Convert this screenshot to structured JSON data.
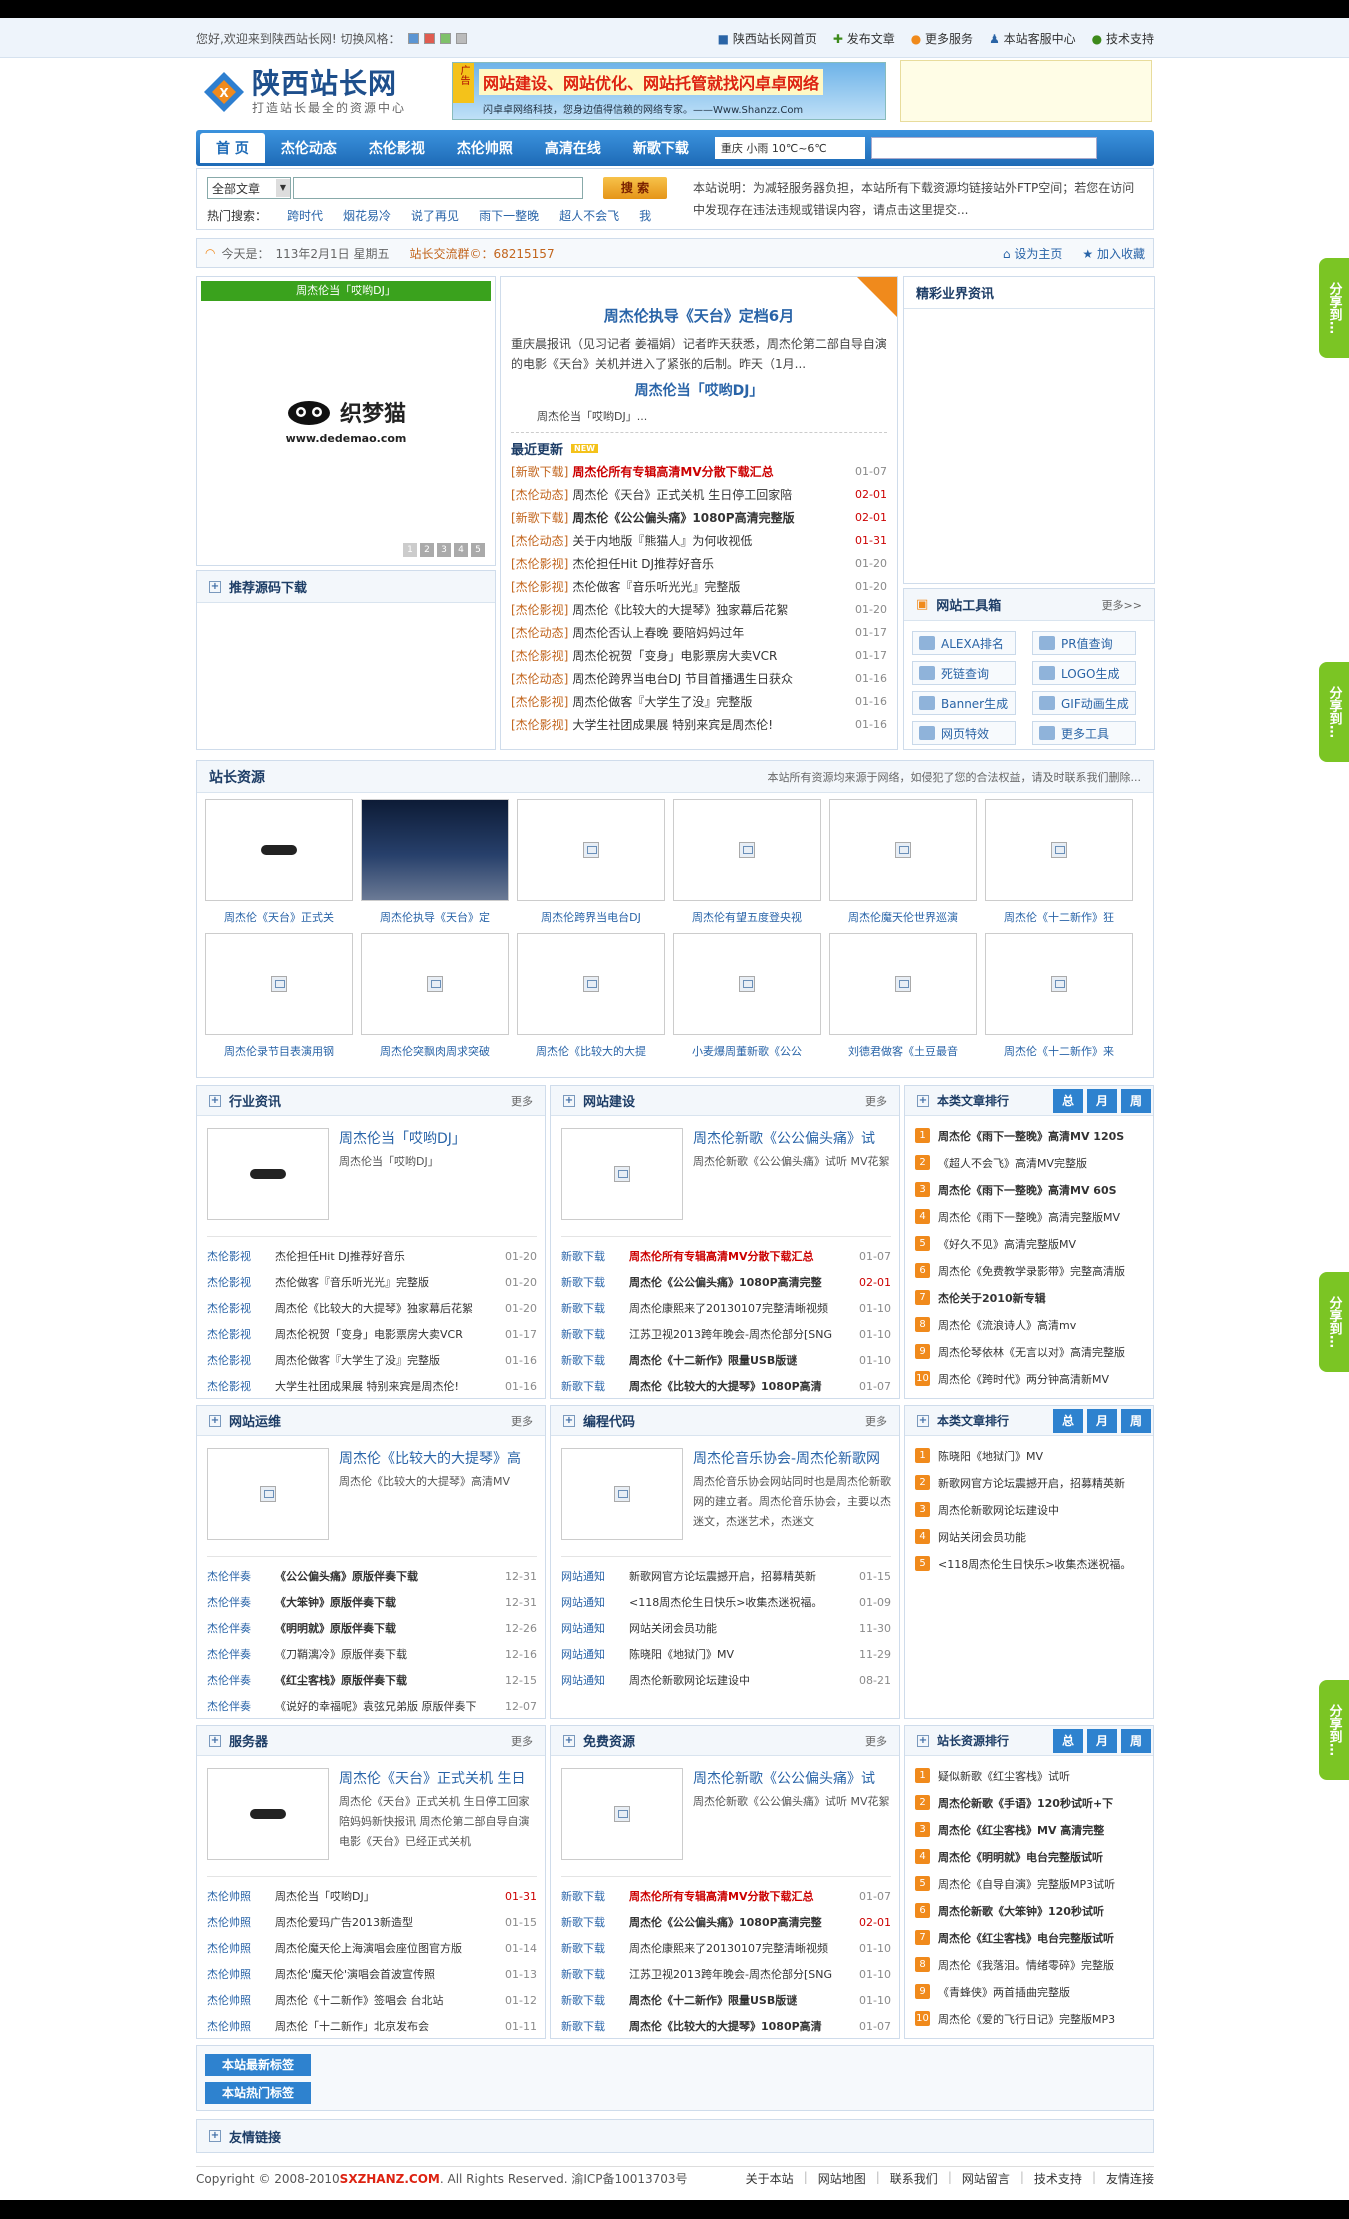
{
  "topbar": {
    "welcome": "您好,欢迎来到陕西站长网! 切换风格：",
    "links": [
      "陕西站长网首页",
      "发布文章",
      "更多服务",
      "本站客服中心",
      "技术支持"
    ]
  },
  "logo": {
    "title": "陕西站长网",
    "slogan": "打造站长最全的资源中心"
  },
  "banner": {
    "line1": "网站建设、网站优化、网站托管就找闪卓卓网络",
    "line2": "闪卓卓网络科技，您身边值得信赖的网络专家。——Www.Shanzz.Com",
    "tag": "广告"
  },
  "nav": {
    "items": [
      "首 页",
      "杰伦动态",
      "杰伦影视",
      "杰伦帅照",
      "高清在线",
      "新歌下载"
    ],
    "weather": "重庆  小雨 10℃~6℃"
  },
  "search": {
    "select": "全部文章",
    "button": "搜 索",
    "hot_label": "热门搜索：",
    "hot": [
      "跨时代",
      "烟花易冷",
      "说了再见",
      "雨下一整晚",
      "超人不会飞",
      "我"
    ],
    "notice": "本站说明：为减轻服务器负担，本站所有下载资源均链接站外FTP空间；若您在访问中发现存在违法违规或错误内容，请点击这里提交..."
  },
  "infobar": {
    "today": "今天是：",
    "date": "113年2月1日 星期五",
    "qq": "站长交流群©：68215157",
    "home": "设为主页",
    "fav": "加入收藏"
  },
  "focus": {
    "caption": "周杰伦当「哎哟DJ」",
    "logo_cn": "织梦猫",
    "logo_en": "www.dedemao.com",
    "pages": [
      "1",
      "2",
      "3",
      "4",
      "5"
    ]
  },
  "headline": {
    "title1": "周杰伦执导《天台》定档6月",
    "desc1": "重庆晨报讯（见习记者 姜福娟）记者昨天获悉，周杰伦第二部自导自演的电影《天台》关机并进入了紧张的后制。昨天（1月...",
    "title2": "周杰伦当「哎哟DJ」",
    "desc2": "周杰伦当「哎哟DJ」..."
  },
  "latest": {
    "title": "最近更新",
    "new": "NEW",
    "items": [
      {
        "cat": "[新歌下载]",
        "text": "周杰伦所有专辑高清MV分散下载汇总",
        "date": "01-07",
        "style": "red"
      },
      {
        "cat": "[杰伦动态]",
        "text": "周杰伦《天台》正式关机 生日停工回家陪",
        "date": "02-01",
        "style": "",
        "dred": true
      },
      {
        "cat": "[新歌下载]",
        "text": "周杰伦《公公偏头痛》1080P高清完整版",
        "date": "02-01",
        "style": "bold",
        "dred": true
      },
      {
        "cat": "[杰伦动态]",
        "text": "关于内地版『熊猫人』为何收视低",
        "date": "01-31",
        "style": "",
        "dred": true
      },
      {
        "cat": "[杰伦影视]",
        "text": "杰伦担任Hit DJ推荐好音乐",
        "date": "01-20",
        "style": ""
      },
      {
        "cat": "[杰伦影视]",
        "text": "杰伦做客『音乐听光光』完整版",
        "date": "01-20",
        "style": ""
      },
      {
        "cat": "[杰伦影视]",
        "text": "周杰伦《比较大的大提琴》独家幕后花絮",
        "date": "01-20",
        "style": ""
      },
      {
        "cat": "[杰伦动态]",
        "text": "周杰伦否认上春晚 要陪妈妈过年",
        "date": "01-17",
        "style": ""
      },
      {
        "cat": "[杰伦影视]",
        "text": "周杰伦祝贺「变身」电影票房大卖VCR",
        "date": "01-17",
        "style": ""
      },
      {
        "cat": "[杰伦动态]",
        "text": "周杰伦跨界当电台DJ 节目首播遇生日获众",
        "date": "01-16",
        "style": ""
      },
      {
        "cat": "[杰伦影视]",
        "text": "周杰伦做客『大学生了没』完整版",
        "date": "01-16",
        "style": ""
      },
      {
        "cat": "[杰伦影视]",
        "text": "大学生社团成果展 特别来宾是周杰伦!",
        "date": "01-16",
        "style": ""
      }
    ]
  },
  "industry_news": {
    "title": "精彩业界资讯"
  },
  "source_dl": {
    "title": "推荐源码下载"
  },
  "toolbox": {
    "title": "网站工具箱",
    "more": "更多>>",
    "tools": [
      "ALEXA排名",
      "PR值查询",
      "死链查询",
      "LOGO生成",
      "Banner生成",
      "GIF动画生成",
      "网页特效",
      "更多工具"
    ]
  },
  "resources": {
    "title": "站长资源",
    "note": "本站所有资源均来源于网络，如侵犯了您的合法权益，请及时联系我们删除...",
    "row1": [
      "周杰伦《天台》正式关",
      "周杰伦执导《天台》定",
      "周杰伦跨界当电台DJ",
      "周杰伦有望五度登央视",
      "周杰伦魔天伦世界巡演",
      "周杰伦《十二新作》狂"
    ],
    "row2": [
      "周杰伦录节目表演用钢",
      "周杰伦突飘肉周求突破",
      "周杰伦《比较大的大提",
      "小麦爆周董新歌《公公",
      "刘德君做客《土豆最音",
      "周杰伦《十二新作》来"
    ]
  },
  "panels": [
    {
      "title": "行业资讯",
      "more": "更多",
      "feat_title": "周杰伦当「哎哟DJ」",
      "feat_desc": "周杰伦当「哎哟DJ」",
      "feat_logo": true,
      "rows": [
        {
          "cat": "杰伦影视",
          "text": "杰伦担任Hit DJ推荐好音乐",
          "date": "01-20"
        },
        {
          "cat": "杰伦影视",
          "text": "杰伦做客『音乐听光光』完整版",
          "date": "01-20"
        },
        {
          "cat": "杰伦影视",
          "text": "周杰伦《比较大的大提琴》独家幕后花絮",
          "date": "01-20"
        },
        {
          "cat": "杰伦影视",
          "text": "周杰伦祝贺「变身」电影票房大卖VCR",
          "date": "01-17"
        },
        {
          "cat": "杰伦影视",
          "text": "周杰伦做客『大学生了没』完整版",
          "date": "01-16"
        },
        {
          "cat": "杰伦影视",
          "text": "大学生社团成果展 特别来宾是周杰伦!",
          "date": "01-16"
        }
      ]
    },
    {
      "title": "网站建设",
      "more": "更多",
      "feat_title": "周杰伦新歌《公公偏头痛》试",
      "feat_desc": "周杰伦新歌《公公偏头痛》试听 MV花絮",
      "feat_logo": false,
      "rows": [
        {
          "cat": "新歌下载",
          "text": "周杰伦所有专辑高清MV分散下载汇总",
          "date": "01-07",
          "style": "red"
        },
        {
          "cat": "新歌下载",
          "text": "周杰伦《公公偏头痛》1080P高清完整",
          "date": "02-01",
          "style": "bold",
          "dred": true
        },
        {
          "cat": "新歌下载",
          "text": "周杰伦康熙来了20130107完整清晰视频",
          "date": "01-10"
        },
        {
          "cat": "新歌下载",
          "text": "江苏卫视2013跨年晚会-周杰伦部分[SNG",
          "date": "01-10"
        },
        {
          "cat": "新歌下载",
          "text": "周杰伦《十二新作》限量USB版谜",
          "date": "01-10",
          "style": "bold"
        },
        {
          "cat": "新歌下载",
          "text": "周杰伦《比较大的大提琴》1080P高清",
          "date": "01-07",
          "style": "bold"
        }
      ]
    },
    {
      "title": "网站运维",
      "more": "更多",
      "feat_title": "周杰伦《比较大的大提琴》高",
      "feat_desc": "周杰伦《比较大的大提琴》高清MV",
      "feat_logo": false,
      "rows": [
        {
          "cat": "杰伦伴奏",
          "text": "《公公偏头痛》原版伴奏下载",
          "date": "12-31",
          "style": "bold"
        },
        {
          "cat": "杰伦伴奏",
          "text": "《大笨钟》原版伴奏下载",
          "date": "12-31",
          "style": "bold"
        },
        {
          "cat": "杰伦伴奏",
          "text": "《明明就》原版伴奏下载",
          "date": "12-26",
          "style": "bold"
        },
        {
          "cat": "杰伦伴奏",
          "text": "《刀鞘漓冷》原版伴奏下载",
          "date": "12-16"
        },
        {
          "cat": "杰伦伴奏",
          "text": "《红尘客栈》原版伴奏下载",
          "date": "12-15",
          "style": "bold"
        },
        {
          "cat": "杰伦伴奏",
          "text": "《说好的幸福呢》袁弦兄弟版 原版伴奏下",
          "date": "12-07"
        }
      ]
    },
    {
      "title": "编程代码",
      "more": "更多",
      "feat_title": "周杰伦音乐协会-周杰伦新歌网",
      "feat_desc": "周杰伦音乐协会网站同时也是周杰伦新歌网的建立者。周杰伦音乐协会，主要以杰迷文，杰迷艺术，杰迷文",
      "feat_logo": false,
      "rows": [
        {
          "cat": "网站通知",
          "text": "新歌网官方论坛震撼开启，招募精英新",
          "date": "01-15"
        },
        {
          "cat": "网站通知",
          "text": "<118周杰伦生日快乐>收集杰迷祝福。",
          "date": "01-09"
        },
        {
          "cat": "网站通知",
          "text": "网站关闭会员功能",
          "date": "11-30"
        },
        {
          "cat": "网站通知",
          "text": "陈晓阳《地狱门》MV",
          "date": "11-29"
        },
        {
          "cat": "网站通知",
          "text": "周杰伦新歌网论坛建设中",
          "date": "08-21"
        }
      ]
    },
    {
      "title": "服务器",
      "more": "更多",
      "feat_title": "周杰伦《天台》正式关机 生日",
      "feat_desc": "周杰伦《天台》正式关机 生日停工回家陪妈妈新快报讯 周杰伦第二部自导自演电影《天台》已经正式关机",
      "feat_logo": true,
      "rows": [
        {
          "cat": "杰伦帅照",
          "text": "周杰伦当「哎哟DJ」",
          "date": "01-31",
          "dred": true
        },
        {
          "cat": "杰伦帅照",
          "text": "周杰伦爱玛广告2013新造型",
          "date": "01-15"
        },
        {
          "cat": "杰伦帅照",
          "text": "周杰伦魔天伦上海演唱会座位图官方版",
          "date": "01-14"
        },
        {
          "cat": "杰伦帅照",
          "text": "周杰伦'魔天伦'演唱会首波宣传照",
          "date": "01-13"
        },
        {
          "cat": "杰伦帅照",
          "text": "周杰伦《十二新作》签唱会 台北站",
          "date": "01-12"
        },
        {
          "cat": "杰伦帅照",
          "text": "周杰伦「十二新作」北京发布会",
          "date": "01-11"
        }
      ]
    },
    {
      "title": "免费资源",
      "more": "更多",
      "feat_title": "周杰伦新歌《公公偏头痛》试",
      "feat_desc": "周杰伦新歌《公公偏头痛》试听 MV花絮",
      "feat_logo": false,
      "rows": [
        {
          "cat": "新歌下载",
          "text": "周杰伦所有专辑高清MV分散下载汇总",
          "date": "01-07",
          "style": "red"
        },
        {
          "cat": "新歌下载",
          "text": "周杰伦《公公偏头痛》1080P高清完整",
          "date": "02-01",
          "style": "bold",
          "dred": true
        },
        {
          "cat": "新歌下载",
          "text": "周杰伦康熙来了20130107完整清晰视频",
          "date": "01-10"
        },
        {
          "cat": "新歌下载",
          "text": "江苏卫视2013跨年晚会-周杰伦部分[SNG",
          "date": "01-10"
        },
        {
          "cat": "新歌下载",
          "text": "周杰伦《十二新作》限量USB版谜",
          "date": "01-10",
          "style": "bold"
        },
        {
          "cat": "新歌下载",
          "text": "周杰伦《比较大的大提琴》1080P高清",
          "date": "01-07",
          "style": "bold"
        }
      ]
    }
  ],
  "rankings": [
    {
      "title": "本类文章排行",
      "tabs": [
        "总",
        "月",
        "周"
      ],
      "items": [
        {
          "text": "周杰伦《雨下一整晚》高清MV 120S",
          "bold": true
        },
        {
          "text": "《超人不会飞》高清MV完整版"
        },
        {
          "text": "周杰伦《雨下一整晚》高清MV 60S",
          "bold": true
        },
        {
          "text": "周杰伦《雨下一整晚》高清完整版MV"
        },
        {
          "text": "《好久不见》高清完整版MV"
        },
        {
          "text": "周杰伦《免费教学录影带》完整高清版"
        },
        {
          "text": "杰伦关于2010新专辑",
          "bold": true
        },
        {
          "text": "周杰伦《流浪诗人》高清mv"
        },
        {
          "text": "周杰伦琴依林《无言以对》高清完整版"
        },
        {
          "text": "周杰伦《跨时代》两分钟高清新MV"
        }
      ]
    },
    {
      "title": "本类文章排行",
      "tabs": [
        "总",
        "月",
        "周"
      ],
      "items": [
        {
          "text": "陈晓阳《地狱门》MV"
        },
        {
          "text": "新歌网官方论坛震撼开启，招募精英新"
        },
        {
          "text": "周杰伦新歌网论坛建设中"
        },
        {
          "text": "网站关闭会员功能"
        },
        {
          "text": "<118周杰伦生日快乐>收集杰迷祝福。"
        }
      ]
    },
    {
      "title": "站长资源排行",
      "tabs": [
        "总",
        "月",
        "周"
      ],
      "items": [
        {
          "text": "疑似新歌《红尘客栈》试听"
        },
        {
          "text": "周杰伦新歌《手语》120秒试听+下",
          "bold": true
        },
        {
          "text": "周杰伦《红尘客栈》MV 高清完整",
          "bold": true
        },
        {
          "text": "周杰伦《明明就》电台完整版试听",
          "bold": true
        },
        {
          "text": "周杰伦《自导自演》完整版MP3试听"
        },
        {
          "text": "周杰伦新歌《大笨钟》120秒试听",
          "bold": true
        },
        {
          "text": "周杰伦《红尘客栈》电台完整版试听",
          "bold": true
        },
        {
          "text": "周杰伦《我落泪。情绪零碎》完整版"
        },
        {
          "text": "《青蜂侠》两首插曲完整版"
        },
        {
          "text": "周杰伦《爱的飞行日记》完整版MP3"
        }
      ]
    }
  ],
  "tags": {
    "latest": "本站最新标签",
    "hot": "本站热门标签"
  },
  "friendlinks": {
    "title": "友情链接"
  },
  "footer": {
    "copyright": "Copyright © 2008-2010 ",
    "domain": "SXZHANZ.COM",
    "rights": ". All Rights Reserved. 渝ICP备10013703号",
    "links": [
      "关于本站",
      "网站地图",
      "联系我们",
      "网站留言",
      "技术支持",
      "友情连接"
    ]
  },
  "share": {
    "label": "分享到…"
  },
  "colors": {
    "nav": "#2479c6",
    "accent": "#f08a1c",
    "share": "#7bc524",
    "link_red": "#cc0000",
    "cat": "#c2651d"
  }
}
